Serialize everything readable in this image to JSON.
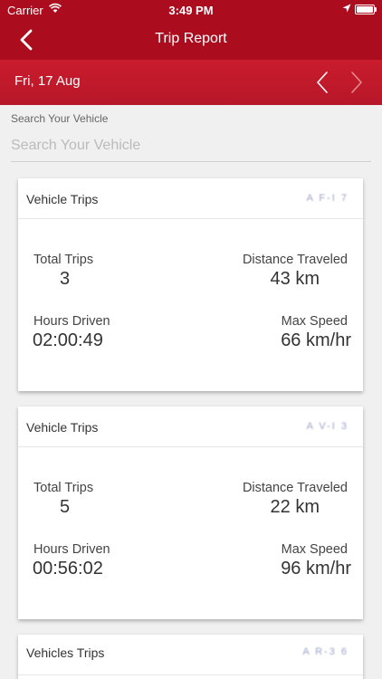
{
  "status_bar": {
    "carrier": "Carrier",
    "time": "3:49 PM"
  },
  "nav": {
    "title": "Trip Report"
  },
  "date_bar": {
    "date": "Fri, 17 Aug"
  },
  "search": {
    "label": "Search Your Vehicle",
    "placeholder": "Search Your Vehicle",
    "value": ""
  },
  "labels": {
    "total_trips": "Total Trips",
    "distance_traveled": "Distance Traveled",
    "hours_driven": "Hours Driven",
    "max_speed": "Max Speed"
  },
  "cards": [
    {
      "title": "Vehicle Trips",
      "plate": "A F-I 7",
      "total_trips": "3",
      "distance": "43 km",
      "hours_driven": "02:00:49",
      "max_speed": "66 km/hr"
    },
    {
      "title": "Vehicle Trips",
      "plate": "A V-I 3",
      "total_trips": "5",
      "distance": "22 km",
      "hours_driven": "00:56:02",
      "max_speed": "96 km/hr"
    },
    {
      "title": "Vehicles Trips",
      "plate": "A R-3 6"
    }
  ],
  "colors": {
    "header": "#ab0d1f",
    "date_bar": "#c01a2b",
    "background": "#f0f0f0"
  }
}
